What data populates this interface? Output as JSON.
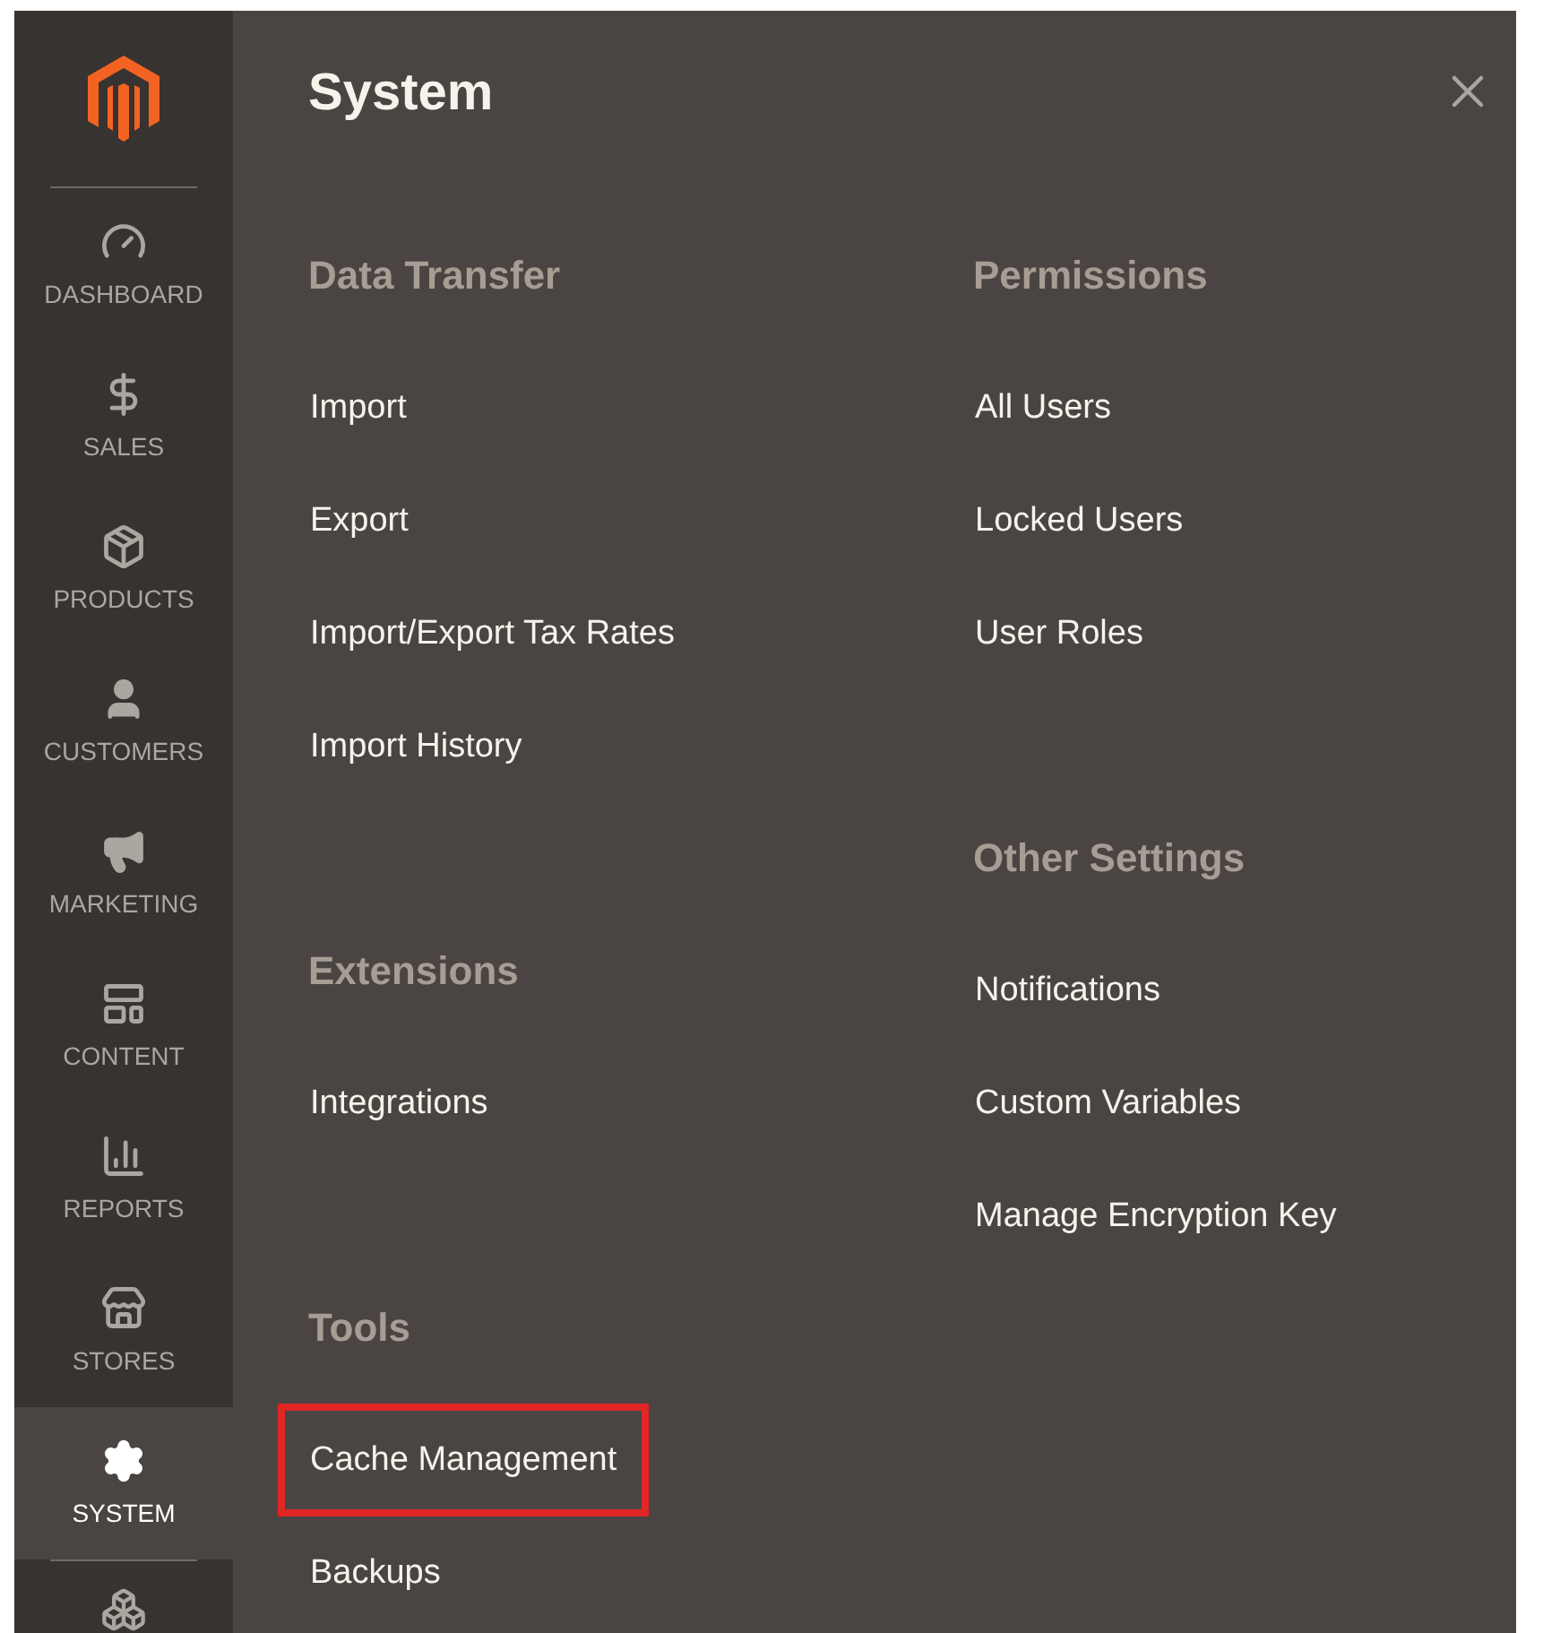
{
  "sidebar": {
    "items": [
      {
        "label": "DASHBOARD",
        "selected": false
      },
      {
        "label": "SALES",
        "selected": false
      },
      {
        "label": "PRODUCTS",
        "selected": false
      },
      {
        "label": "CUSTOMERS",
        "selected": false
      },
      {
        "label": "MARKETING",
        "selected": false
      },
      {
        "label": "CONTENT",
        "selected": false
      },
      {
        "label": "REPORTS",
        "selected": false
      },
      {
        "label": "STORES",
        "selected": false
      },
      {
        "label": "SYSTEM",
        "selected": true
      }
    ]
  },
  "menu": {
    "title": "System",
    "columns": [
      {
        "sections": [
          {
            "heading": "Data Transfer",
            "items": [
              {
                "label": "Import",
                "highlighted": false
              },
              {
                "label": "Export",
                "highlighted": false
              },
              {
                "label": "Import/Export Tax Rates",
                "highlighted": false
              },
              {
                "label": "Import History",
                "highlighted": false
              }
            ]
          },
          {
            "heading": "Extensions",
            "items": [
              {
                "label": "Integrations",
                "highlighted": false
              }
            ]
          },
          {
            "heading": "Tools",
            "items": [
              {
                "label": "Cache Management",
                "highlighted": true
              },
              {
                "label": "Backups",
                "highlighted": false
              }
            ]
          }
        ]
      },
      {
        "sections": [
          {
            "heading": "Permissions",
            "items": [
              {
                "label": "All Users",
                "highlighted": false
              },
              {
                "label": "Locked Users",
                "highlighted": false
              },
              {
                "label": "User Roles",
                "highlighted": false
              }
            ]
          },
          {
            "heading": "Other Settings",
            "items": [
              {
                "label": "Notifications",
                "highlighted": false
              },
              {
                "label": "Custom Variables",
                "highlighted": false
              },
              {
                "label": "Manage Encryption Key",
                "highlighted": false
              }
            ]
          }
        ]
      }
    ]
  }
}
